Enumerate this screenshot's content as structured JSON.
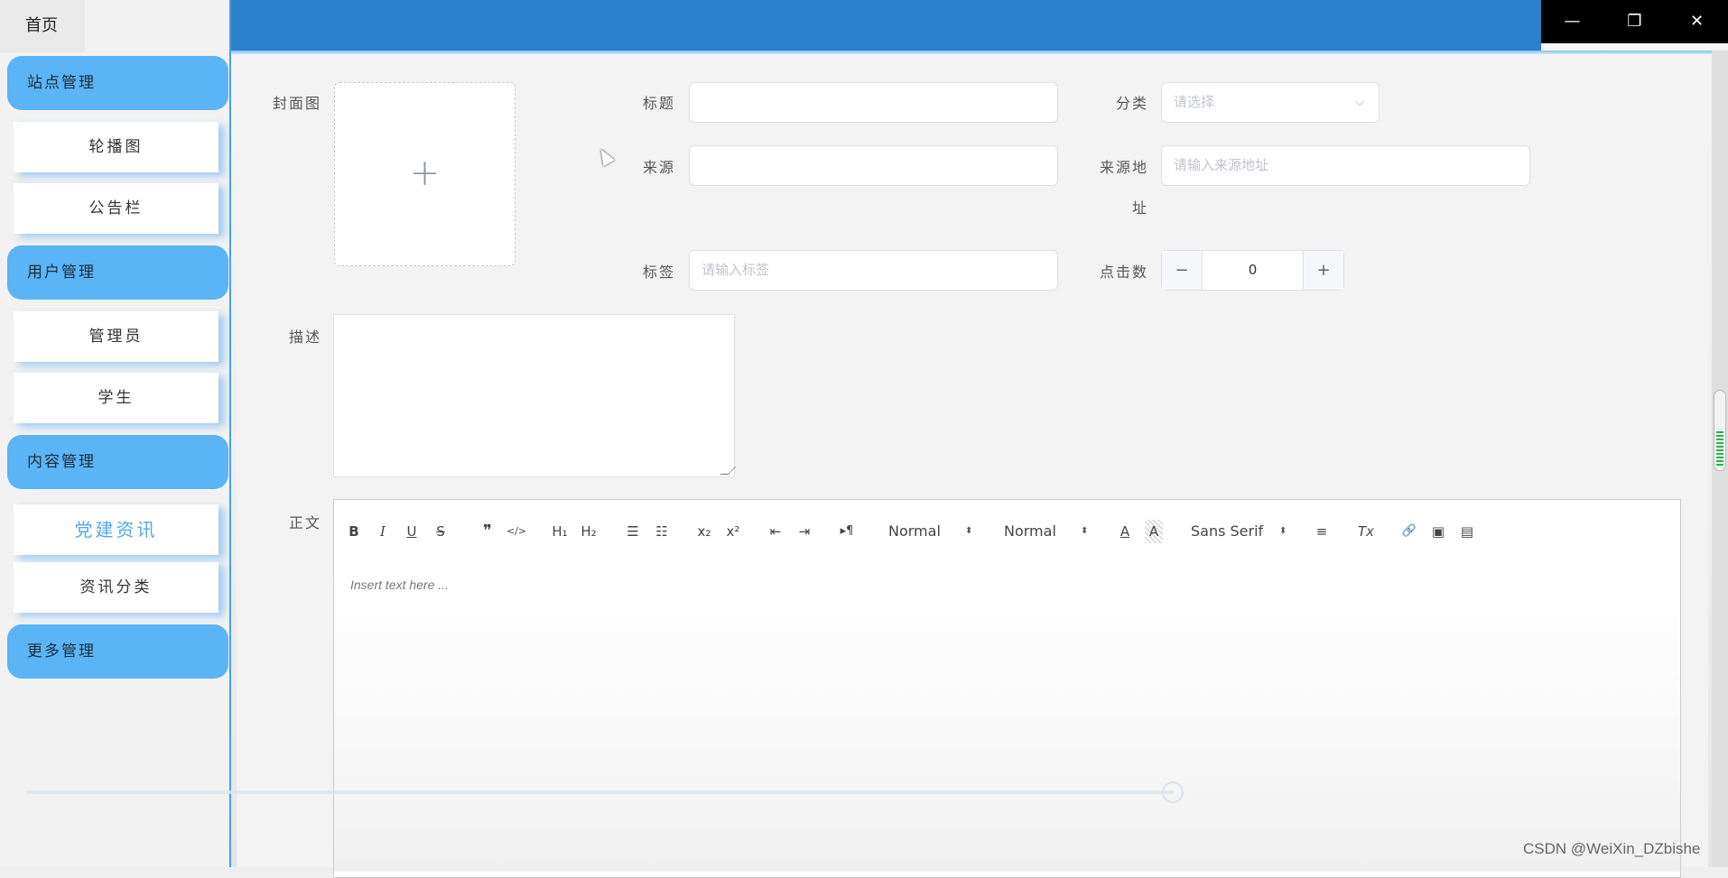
{
  "sidebar": {
    "home": "首页",
    "groups": [
      {
        "label": "站点管理",
        "items": [
          "轮播图",
          "公告栏"
        ]
      },
      {
        "label": "用户管理",
        "items": [
          "管理员",
          "学生"
        ]
      },
      {
        "label": "内容管理",
        "items": [
          "党建资讯",
          "资讯分类"
        ]
      },
      {
        "label": "更多管理",
        "items": []
      }
    ],
    "active_item": "党建资讯"
  },
  "window_controls": {
    "minimize": "—",
    "restore": "❐",
    "close": "✕"
  },
  "form": {
    "cover_label": "封面图",
    "upload_plus": "+",
    "title_label": "标题",
    "title_value": "",
    "category_label": "分类",
    "category_placeholder": "请选择",
    "source_label": "来源",
    "source_value": "",
    "source_url_label_1": "来源地",
    "source_url_label_2": "址",
    "source_url_placeholder": "请输入来源地址",
    "tags_label": "标签",
    "tags_placeholder": "请输入标签",
    "clicks_label": "点击数",
    "clicks_value": "0",
    "clicks_minus": "−",
    "clicks_plus": "+",
    "desc_label": "描述",
    "body_label": "正文"
  },
  "editor": {
    "toolbar": {
      "bold": "B",
      "italic": "I",
      "underline": "U",
      "strike": "S",
      "blockquote": "❞",
      "code": "</>",
      "h1": "H₁",
      "h2": "H₂",
      "ordered_list": "☰",
      "bullet_list": "☷",
      "subscript": "x₂",
      "superscript": "x²",
      "outdent": "⇤",
      "indent": "⇥",
      "rtl": "▸¶",
      "size_select": "Normal",
      "header_select": "Normal",
      "color": "A",
      "background": "A",
      "font_select": "Sans Serif",
      "align": "≡",
      "clean": "Tx",
      "link": "🔗",
      "image": "▣",
      "video": "▤"
    },
    "placeholder": "Insert text here ..."
  },
  "watermark": "CSDN @WeiXin_DZbishe"
}
